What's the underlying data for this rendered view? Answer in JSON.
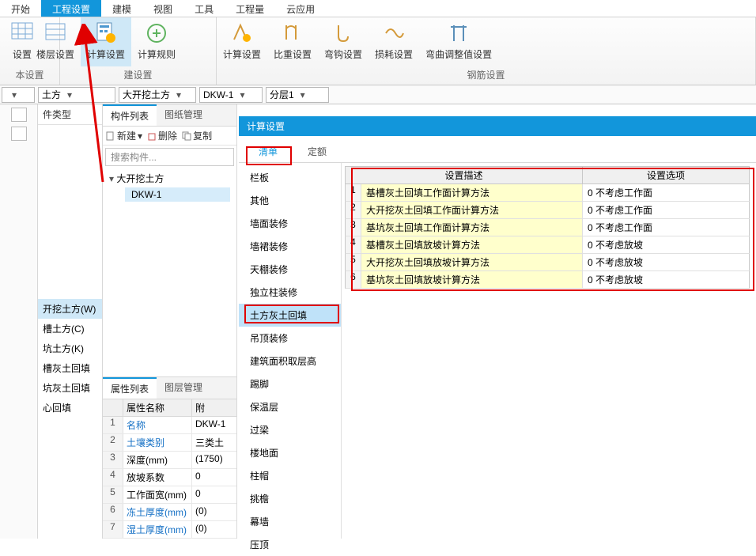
{
  "top_tabs": [
    "开始",
    "工程设置",
    "建模",
    "视图",
    "工具",
    "工程量",
    "云应用"
  ],
  "top_active": 1,
  "ribbon": {
    "group1": {
      "items": [
        {
          "label": "设置"
        },
        {
          "label": "楼层设置"
        },
        {
          "label": "计算设置"
        },
        {
          "label": "计算规则"
        }
      ],
      "title": "本设置",
      "title2": "建设置"
    },
    "group2": {
      "items": [
        {
          "label": "计算设置"
        },
        {
          "label": "比重设置"
        },
        {
          "label": "弯钩设置"
        },
        {
          "label": "损耗设置"
        },
        {
          "label": "弯曲调整值设置"
        }
      ],
      "title": "钢筋设置"
    }
  },
  "dd_row": {
    "a": "",
    "b": "土方",
    "c": "大开挖土方",
    "d": "DKW-1",
    "e": "分层1"
  },
  "types_head": "件类型",
  "types": [
    "开挖土方(W)",
    "槽土方(C)",
    "坑土方(K)",
    "槽灰土回填",
    "坑灰土回填",
    "心回填"
  ],
  "types_sel": 0,
  "mid": {
    "tabs": [
      "构件列表",
      "图纸管理"
    ],
    "toolbar": {
      "new": "新建",
      "del": "删除",
      "copy": "复制"
    },
    "search_ph": "搜索构件...",
    "tree_parent": "大开挖土方",
    "tree_child": "DKW-1"
  },
  "prop_tabs": [
    "属性列表",
    "图层管理"
  ],
  "prop_head": {
    "name": "属性名称",
    "val": "附"
  },
  "props": [
    {
      "n": "1",
      "k": "名称",
      "v": "DKW-1",
      "link": true
    },
    {
      "n": "2",
      "k": "土壤类别",
      "v": "三类土",
      "link": true
    },
    {
      "n": "3",
      "k": "深度(mm)",
      "v": "(1750)"
    },
    {
      "n": "4",
      "k": "放坡系数",
      "v": "0"
    },
    {
      "n": "5",
      "k": "工作面宽(mm)",
      "v": "0"
    },
    {
      "n": "6",
      "k": "冻土厚度(mm)",
      "v": "(0)",
      "link": true
    },
    {
      "n": "7",
      "k": "湿土厚度(mm)",
      "v": "(0)",
      "link": true
    }
  ],
  "dlg": {
    "title": "计算设置",
    "tabs": [
      "清单",
      "定额"
    ],
    "cats": [
      "栏板",
      "其他",
      "墙面装修",
      "墙裙装修",
      "天棚装修",
      "独立柱装修",
      "土方灰土回填",
      "吊顶装修",
      "建筑面积取层高",
      "踢脚",
      "保温层",
      "过梁",
      "楼地面",
      "柱帽",
      "挑檐",
      "幕墙",
      "压顶"
    ],
    "cat_sel": 6,
    "head": {
      "desc": "设置描述",
      "opt": "设置选项"
    },
    "rows": [
      {
        "n": "1",
        "d": "基槽灰土回填工作面计算方法",
        "o": "0 不考虑工作面"
      },
      {
        "n": "2",
        "d": "大开挖灰土回填工作面计算方法",
        "o": "0 不考虑工作面"
      },
      {
        "n": "3",
        "d": "基坑灰土回填工作面计算方法",
        "o": "0 不考虑工作面"
      },
      {
        "n": "4",
        "d": "基槽灰土回填放坡计算方法",
        "o": "0 不考虑放坡"
      },
      {
        "n": "5",
        "d": "大开挖灰土回填放坡计算方法",
        "o": "0 不考虑放坡"
      },
      {
        "n": "6",
        "d": "基坑灰土回填放坡计算方法",
        "o": "0 不考虑放坡"
      }
    ]
  }
}
